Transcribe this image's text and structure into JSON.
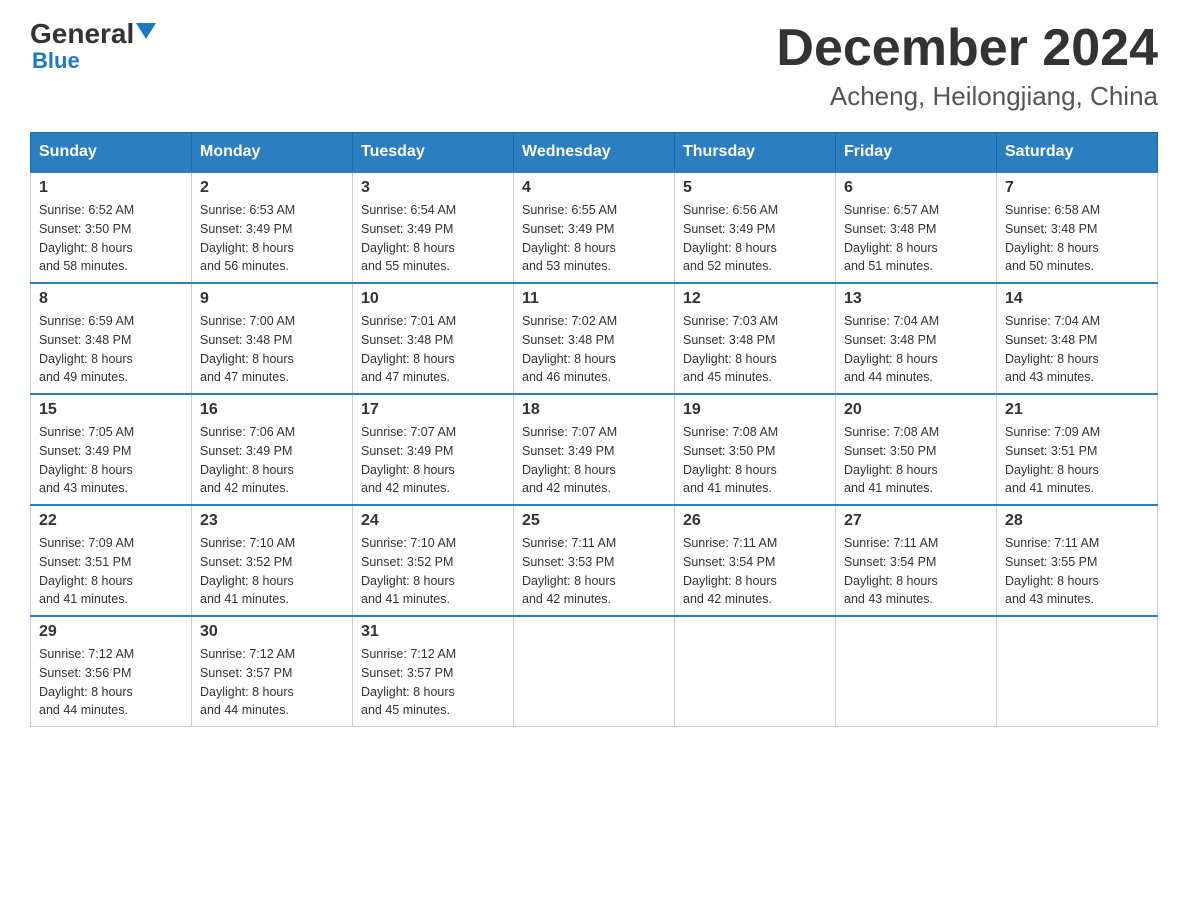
{
  "header": {
    "logo": {
      "top": "General",
      "bottom": "Blue"
    },
    "title": "December 2024",
    "subtitle": "Acheng, Heilongjiang, China"
  },
  "days_of_week": [
    "Sunday",
    "Monday",
    "Tuesday",
    "Wednesday",
    "Thursday",
    "Friday",
    "Saturday"
  ],
  "weeks": [
    [
      {
        "day": "1",
        "sunrise": "6:52 AM",
        "sunset": "3:50 PM",
        "daylight": "8 hours and 58 minutes."
      },
      {
        "day": "2",
        "sunrise": "6:53 AM",
        "sunset": "3:49 PM",
        "daylight": "8 hours and 56 minutes."
      },
      {
        "day": "3",
        "sunrise": "6:54 AM",
        "sunset": "3:49 PM",
        "daylight": "8 hours and 55 minutes."
      },
      {
        "day": "4",
        "sunrise": "6:55 AM",
        "sunset": "3:49 PM",
        "daylight": "8 hours and 53 minutes."
      },
      {
        "day": "5",
        "sunrise": "6:56 AM",
        "sunset": "3:49 PM",
        "daylight": "8 hours and 52 minutes."
      },
      {
        "day": "6",
        "sunrise": "6:57 AM",
        "sunset": "3:48 PM",
        "daylight": "8 hours and 51 minutes."
      },
      {
        "day": "7",
        "sunrise": "6:58 AM",
        "sunset": "3:48 PM",
        "daylight": "8 hours and 50 minutes."
      }
    ],
    [
      {
        "day": "8",
        "sunrise": "6:59 AM",
        "sunset": "3:48 PM",
        "daylight": "8 hours and 49 minutes."
      },
      {
        "day": "9",
        "sunrise": "7:00 AM",
        "sunset": "3:48 PM",
        "daylight": "8 hours and 47 minutes."
      },
      {
        "day": "10",
        "sunrise": "7:01 AM",
        "sunset": "3:48 PM",
        "daylight": "8 hours and 47 minutes."
      },
      {
        "day": "11",
        "sunrise": "7:02 AM",
        "sunset": "3:48 PM",
        "daylight": "8 hours and 46 minutes."
      },
      {
        "day": "12",
        "sunrise": "7:03 AM",
        "sunset": "3:48 PM",
        "daylight": "8 hours and 45 minutes."
      },
      {
        "day": "13",
        "sunrise": "7:04 AM",
        "sunset": "3:48 PM",
        "daylight": "8 hours and 44 minutes."
      },
      {
        "day": "14",
        "sunrise": "7:04 AM",
        "sunset": "3:48 PM",
        "daylight": "8 hours and 43 minutes."
      }
    ],
    [
      {
        "day": "15",
        "sunrise": "7:05 AM",
        "sunset": "3:49 PM",
        "daylight": "8 hours and 43 minutes."
      },
      {
        "day": "16",
        "sunrise": "7:06 AM",
        "sunset": "3:49 PM",
        "daylight": "8 hours and 42 minutes."
      },
      {
        "day": "17",
        "sunrise": "7:07 AM",
        "sunset": "3:49 PM",
        "daylight": "8 hours and 42 minutes."
      },
      {
        "day": "18",
        "sunrise": "7:07 AM",
        "sunset": "3:49 PM",
        "daylight": "8 hours and 42 minutes."
      },
      {
        "day": "19",
        "sunrise": "7:08 AM",
        "sunset": "3:50 PM",
        "daylight": "8 hours and 41 minutes."
      },
      {
        "day": "20",
        "sunrise": "7:08 AM",
        "sunset": "3:50 PM",
        "daylight": "8 hours and 41 minutes."
      },
      {
        "day": "21",
        "sunrise": "7:09 AM",
        "sunset": "3:51 PM",
        "daylight": "8 hours and 41 minutes."
      }
    ],
    [
      {
        "day": "22",
        "sunrise": "7:09 AM",
        "sunset": "3:51 PM",
        "daylight": "8 hours and 41 minutes."
      },
      {
        "day": "23",
        "sunrise": "7:10 AM",
        "sunset": "3:52 PM",
        "daylight": "8 hours and 41 minutes."
      },
      {
        "day": "24",
        "sunrise": "7:10 AM",
        "sunset": "3:52 PM",
        "daylight": "8 hours and 41 minutes."
      },
      {
        "day": "25",
        "sunrise": "7:11 AM",
        "sunset": "3:53 PM",
        "daylight": "8 hours and 42 minutes."
      },
      {
        "day": "26",
        "sunrise": "7:11 AM",
        "sunset": "3:54 PM",
        "daylight": "8 hours and 42 minutes."
      },
      {
        "day": "27",
        "sunrise": "7:11 AM",
        "sunset": "3:54 PM",
        "daylight": "8 hours and 43 minutes."
      },
      {
        "day": "28",
        "sunrise": "7:11 AM",
        "sunset": "3:55 PM",
        "daylight": "8 hours and 43 minutes."
      }
    ],
    [
      {
        "day": "29",
        "sunrise": "7:12 AM",
        "sunset": "3:56 PM",
        "daylight": "8 hours and 44 minutes."
      },
      {
        "day": "30",
        "sunrise": "7:12 AM",
        "sunset": "3:57 PM",
        "daylight": "8 hours and 44 minutes."
      },
      {
        "day": "31",
        "sunrise": "7:12 AM",
        "sunset": "3:57 PM",
        "daylight": "8 hours and 45 minutes."
      },
      null,
      null,
      null,
      null
    ]
  ]
}
